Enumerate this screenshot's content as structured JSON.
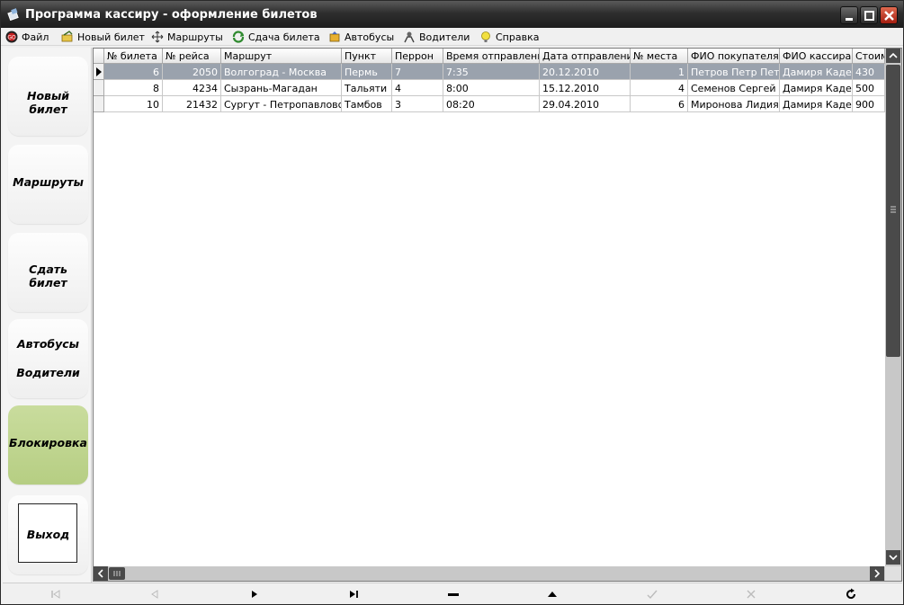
{
  "window": {
    "title": "Программа кассиру - оформление билетов"
  },
  "menu": {
    "items": [
      {
        "label": "Файл",
        "icon": "file-icon"
      },
      {
        "label": "Новый билет",
        "icon": "new-ticket-icon"
      },
      {
        "label": "Маршруты",
        "icon": "routes-icon"
      },
      {
        "label": "Сдача билета",
        "icon": "return-ticket-icon"
      },
      {
        "label": "Автобусы",
        "icon": "bus-icon"
      },
      {
        "label": "Водители",
        "icon": "drivers-icon"
      },
      {
        "label": "Справка",
        "icon": "help-icon"
      }
    ]
  },
  "sidebar": {
    "new_ticket": "Новый билет",
    "routes": "Маршруты",
    "return_ticket": "Сдать билет",
    "buses": "Автобусы",
    "drivers": "Водители",
    "lock": "Блокировка",
    "exit": "Выход",
    "accent_color": "#bfd48e"
  },
  "grid": {
    "columns": [
      "№ билета",
      "№ рейса",
      "Маршрут",
      "Пункт",
      "Перрон",
      "Время отправления",
      "Дата отправления",
      "№ места",
      "ФИО покупателя",
      "ФИО кассира",
      "Стоим"
    ],
    "rows": [
      [
        "6",
        "2050",
        "Волгоград - Москва",
        "Пермь",
        "7",
        "7:35",
        "20.12.2010",
        "1",
        "Петров Петр Петр",
        "Дамиря Кадер",
        "430"
      ],
      [
        "8",
        "4234",
        "Сызрань-Магадан",
        "Тальяти",
        "4",
        "8:00",
        "15.12.2010",
        "4",
        "Семенов Сергей В",
        "Дамиря Кадер",
        "500"
      ],
      [
        "10",
        "21432",
        "Сургут - Петропавловск",
        "Тамбов",
        "3",
        "08:20",
        "29.04.2010",
        "6",
        "Миронова Лидия А.",
        "Дамиря Кадер",
        "900"
      ]
    ],
    "selected_row": 0
  },
  "navigator": {
    "buttons": [
      "first-record-icon",
      "prior-record-icon",
      "next-record-icon",
      "last-record-icon",
      "delete-record-icon",
      "edit-record-icon",
      "post-record-icon",
      "cancel-record-icon",
      "refresh-icon"
    ]
  }
}
